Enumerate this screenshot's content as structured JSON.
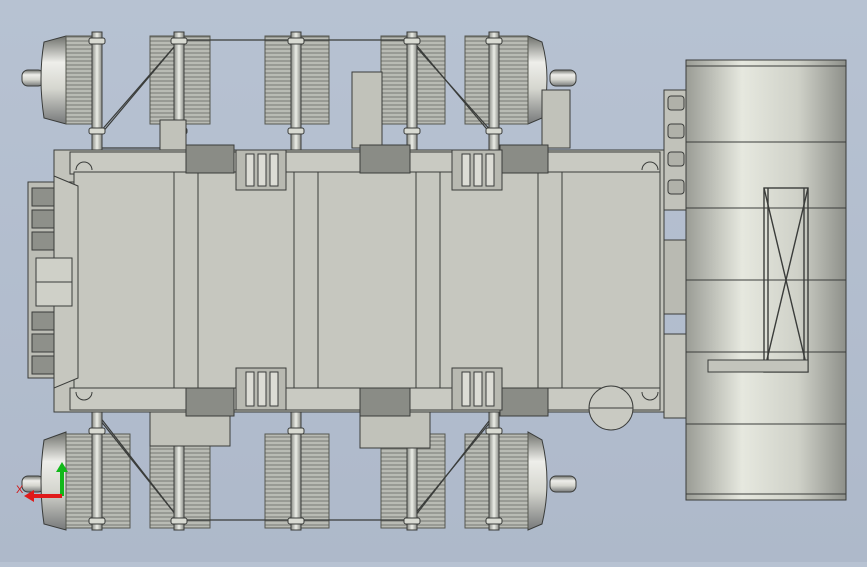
{
  "viewport": {
    "background": "#b3bece"
  },
  "model": {
    "body_color": "#c3c4bc",
    "edge_color": "#3a3c3a",
    "fin_color": "#8c8e88",
    "cylinder_color": "#d6d8cf",
    "dark_part_color": "#7a7c76"
  },
  "triad": {
    "x_label": "X",
    "x_color": "#e01a1a",
    "y_color": "#12b81a",
    "z_color": "#1a36e0"
  }
}
